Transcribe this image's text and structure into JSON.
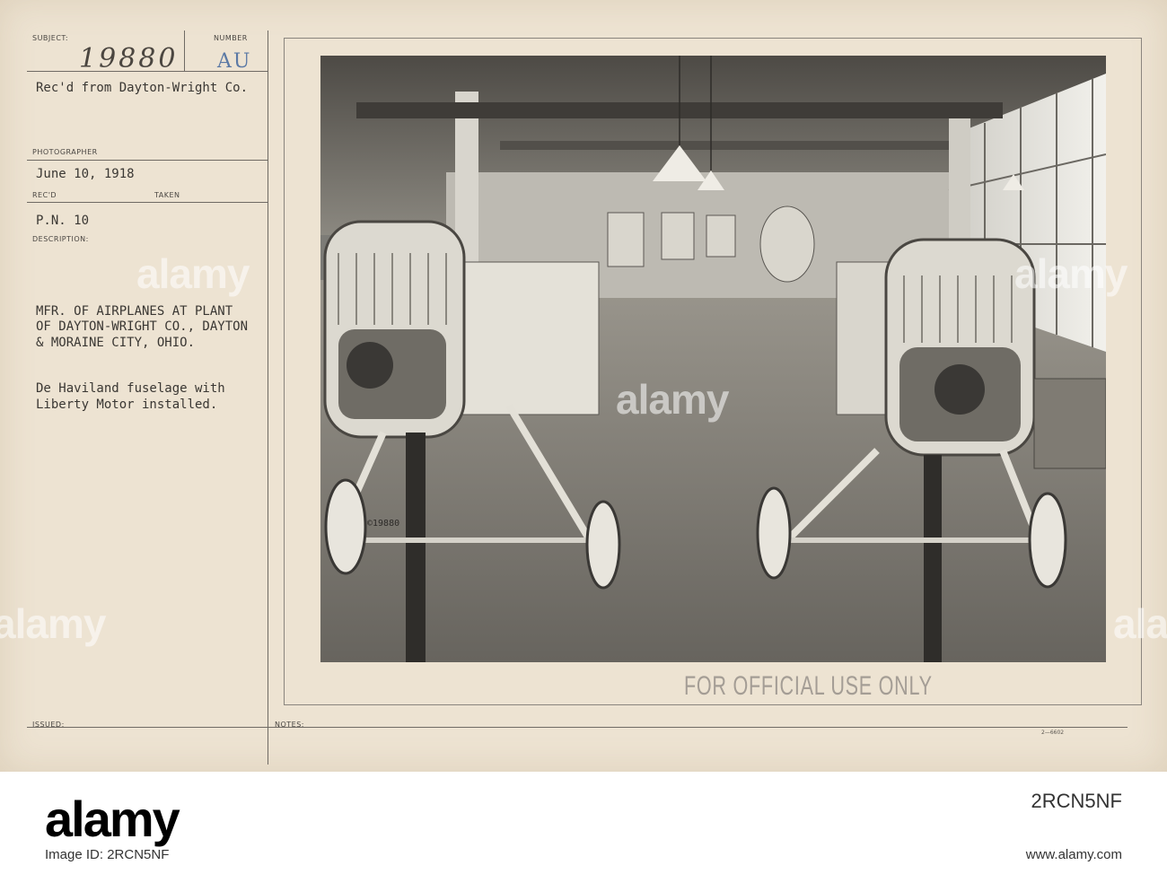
{
  "card": {
    "labels": {
      "subject": "SUBJECT:",
      "number": "NUMBER",
      "photographer": "PHOTOGRAPHER",
      "recd": "REC'D",
      "taken": "TAKEN",
      "description": "DESCRIPTION:",
      "issued": "ISSUED:",
      "notes": "NOTES:"
    },
    "subject_number": "19880",
    "number_code": "AU",
    "received_from": "Rec'd from Dayton-Wright Co.",
    "date": "June 10, 1918",
    "pn": "P.N. 10",
    "description_line1": "MFR. OF AIRPLANES AT PLANT",
    "description_line2": "OF DAYTON-WRIGHT CO., DAYTON",
    "description_line3": "& MORAINE CITY, OHIO.",
    "caption_line1": "De Haviland fuselage with",
    "caption_line2": "Liberty Motor installed.",
    "photo_stamp": "©19880",
    "official_stamp": "FOR OFFICIAL USE ONLY",
    "form_code": "2—6602"
  },
  "watermark": "alamy",
  "footer": {
    "logo": "alamy",
    "image_id": "2RCN5NF",
    "credit": "Image ID: 2RCN5NF",
    "url": "www.alamy.com"
  }
}
